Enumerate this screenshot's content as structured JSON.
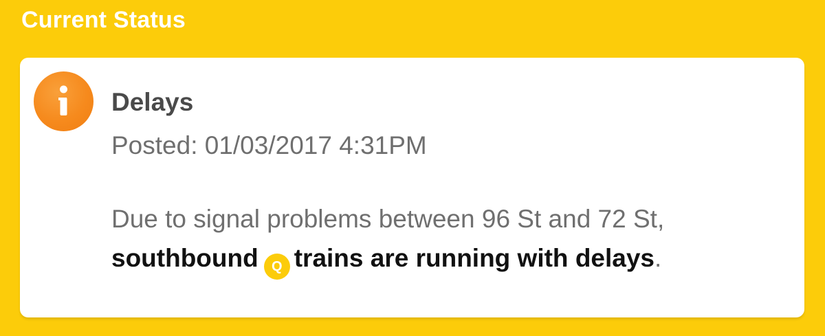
{
  "header": {
    "title": "Current Status"
  },
  "alert": {
    "icon": "info-icon",
    "title": "Delays",
    "posted": "Posted: 01/03/2017 4:31PM",
    "body_line1": "Due to signal problems between 96 St and 72 St,",
    "body_bold_prefix": "southbound",
    "route_bullet": "Q",
    "body_bold_suffix": "trains are running with delays",
    "body_end": "."
  },
  "colors": {
    "background": "#FCCC0A",
    "card": "#FFFFFF",
    "info_icon": "#F68B1F",
    "q_bullet": "#FCCC0A"
  }
}
